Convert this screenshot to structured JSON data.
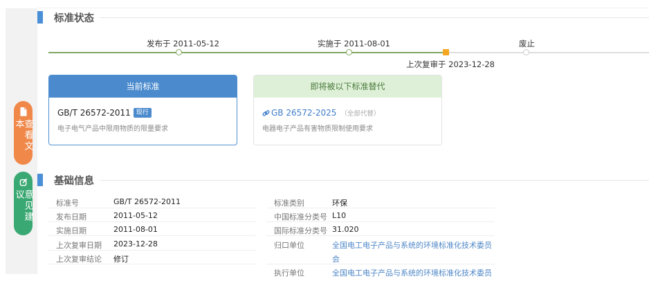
{
  "side": {
    "view_text_label": "查看文本",
    "feedback_label": "意见建议"
  },
  "status_section": {
    "title": "标准状态",
    "timeline": {
      "publish": "发布于 2011-05-12",
      "implement": "实施于 2011-08-01",
      "review": "上次复审于 2023-12-28",
      "abolish": "废止"
    },
    "current_card": {
      "header": "当前标准",
      "code": "GB/T 26572-2011",
      "badge": "现行",
      "name": "电子电气产品中限用物质的限量要求"
    },
    "replace_card": {
      "header": "即将被以下标准替代",
      "code": "GB 26572-2025",
      "note": "（全部代替）",
      "name": "电器电子产品有害物质限制使用要求"
    }
  },
  "basic_section": {
    "title": "基础信息",
    "left": [
      {
        "label": "标准号",
        "value": "GB/T 26572-2011"
      },
      {
        "label": "发布日期",
        "value": "2011-05-12"
      },
      {
        "label": "实施日期",
        "value": "2011-08-01"
      },
      {
        "label": "上次复审日期",
        "value": "2023-12-28"
      },
      {
        "label": "上次复审结论",
        "value": "修订"
      }
    ],
    "right": [
      {
        "label": "标准类别",
        "value": "环保"
      },
      {
        "label": "中国标准分类号",
        "value": "L10"
      },
      {
        "label": "国际标准分类号",
        "value": "31.020"
      },
      {
        "label": "归口单位",
        "value": "全国电工电子产品与系统的环境标准化技术委员"
      },
      {
        "label": "",
        "value": "会"
      },
      {
        "label": "执行单位",
        "value": "全国电工电子产品与系统的环境标准化技术委员"
      }
    ]
  },
  "colors": {
    "accent_blue": "#4a8acd",
    "timeline_green": "#7fa761",
    "review_marker": "#f5a623",
    "view_text_button": "#f0884a",
    "feedback_button": "#3aa872"
  }
}
